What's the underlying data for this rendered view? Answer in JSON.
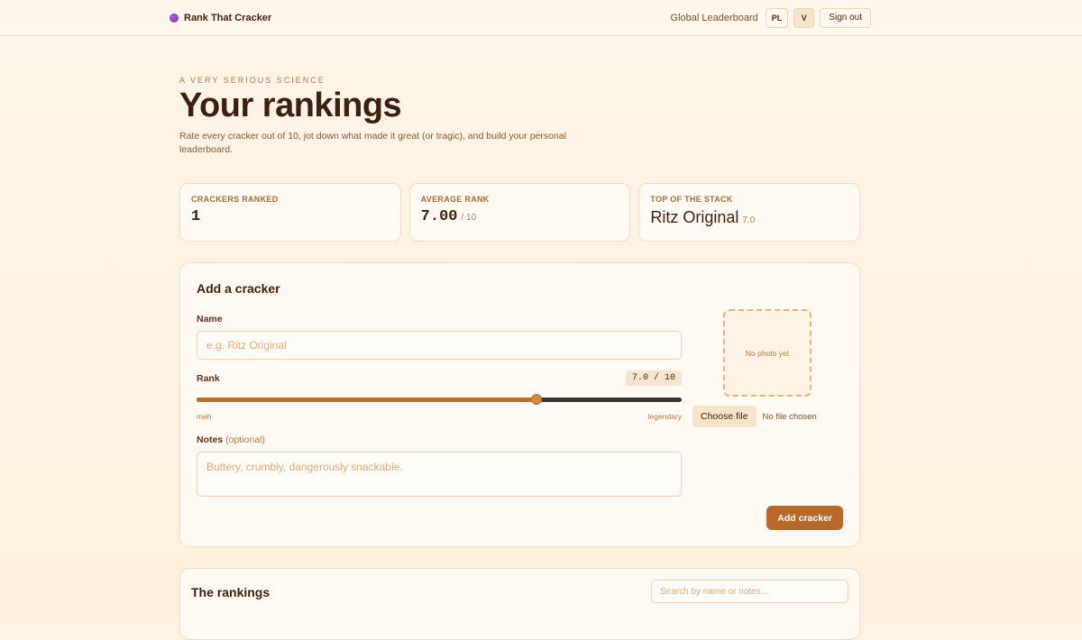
{
  "app": {
    "name": "Rank That Cracker",
    "nav": {
      "leaderboard": "Global Leaderboard",
      "lang": "PL",
      "user_initial": "V",
      "sign_out": "Sign out"
    }
  },
  "hero": {
    "eyebrow": "A VERY SERIOUS SCIENCE",
    "title": "Your rankings",
    "subtitle": "Rate every cracker out of 10, jot down what made it great (or tragic), and build your personal leaderboard."
  },
  "stats": {
    "ranked": {
      "label": "CRACKERS RANKED",
      "value": "1"
    },
    "average": {
      "label": "AVERAGE RANK",
      "value": "7.00",
      "suffix": "/ 10"
    },
    "top": {
      "label": "TOP OF THE STACK",
      "value": "Ritz Original",
      "suffix": "7.0"
    }
  },
  "form": {
    "title": "Add a cracker",
    "name_label": "Name",
    "name_placeholder": "e.g. Ritz Original",
    "rank_label": "Rank",
    "rank_readout": "7.0 / 10",
    "rank_value": 7.0,
    "rank_min_label": "meh",
    "rank_max_label": "legendary",
    "notes_label": "Notes",
    "notes_optional": "(optional)",
    "notes_placeholder": "Buttery, crumbly, dangerously snackable.",
    "photo_placeholder": "No photo yet",
    "choose_file": "Choose file",
    "file_status": "No file chosen",
    "submit": "Add cracker"
  },
  "rankings": {
    "title": "The rankings",
    "search_placeholder": "Search by name or notes..."
  },
  "colors": {
    "accent": "#b8692a",
    "background": "#fdf2e3",
    "text": "#3c1f0e"
  }
}
